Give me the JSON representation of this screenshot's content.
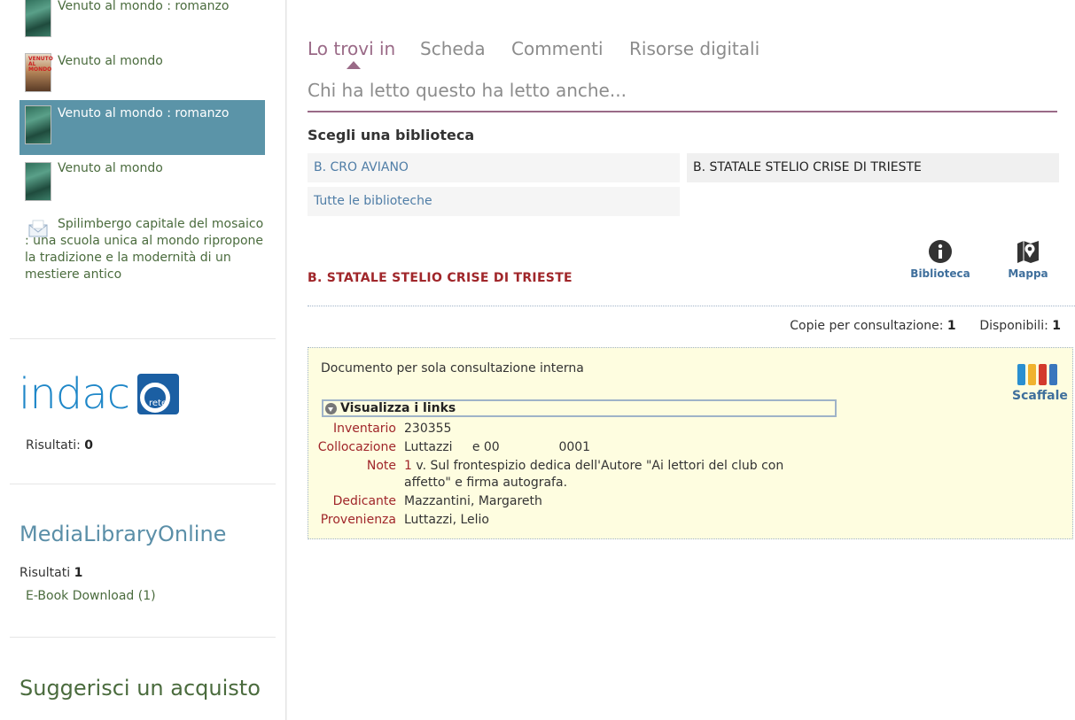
{
  "sidebar": {
    "related": [
      {
        "title": "Venuto al mondo : romanzo",
        "cover": "green"
      },
      {
        "title": "Venuto al mondo",
        "cover": "photo",
        "cover_text": "VENUTO AL MONDO"
      },
      {
        "title": "Venuto al mondo : romanzo",
        "cover": "green",
        "selected": true
      },
      {
        "title": "Venuto al mondo",
        "cover": "green"
      }
    ],
    "related_long": {
      "title": "Spilimbergo capitale del mosaico : una scuola unica al mondo ripropone la tradizione e la modernità di un mestiere antico",
      "icon": "envelope-icon"
    },
    "indaco": {
      "logo_text": "indac",
      "badge_text": "rete",
      "results_label": "Risultati:",
      "results_value": "0"
    },
    "mlol": {
      "heading": "MediaLibraryOnline",
      "results_label": "Risultati",
      "results_value": "1",
      "link": "E-Book Download (1)"
    },
    "suggest": {
      "heading": "Suggerisci un acquisto"
    }
  },
  "tabs": {
    "items": [
      "Lo trovi in",
      "Scheda",
      "Commenti",
      "Risorse digitali"
    ],
    "active": "Lo trovi in",
    "second_row": "Chi ha letto questo ha letto anche..."
  },
  "libraries": {
    "label": "Scegli una biblioteca",
    "options": [
      "B. CRO AVIANO",
      "B. STATALE STELIO CRISE DI TRIESTE",
      "Tutte le biblioteche"
    ],
    "selected": "B. STATALE STELIO CRISE DI TRIESTE"
  },
  "library_detail": {
    "name": "B. STATALE STELIO CRISE DI TRIESTE",
    "biblioteca_label": "Biblioteca",
    "mappa_label": "Mappa",
    "copies_label": "Copie per consultazione:",
    "copies_value": "1",
    "available_label": "Disponibili:",
    "available_value": "1"
  },
  "holding": {
    "description": "Documento per sola consultazione interna",
    "scaffale_label": "Scaffale",
    "links_toggle": "Visualizza i links",
    "fields": [
      {
        "label": "Inventario",
        "value": "230355"
      },
      {
        "label": "Collocazione",
        "value": "Luttazzi     e 00               0001"
      },
      {
        "label": "Note",
        "value_num": "1",
        "value": " v. Sul frontespizio dedica dell'Autore \"Ai lettori del club con affetto\" e firma autografa."
      },
      {
        "label": "Dedicante",
        "value": "Mazzantini, Margareth"
      },
      {
        "label": "Provenienza",
        "value": "Luttazzi, Lelio"
      }
    ]
  },
  "colors": {
    "accent": "#9a6a87",
    "selected_bg": "#5b94a8",
    "link_blue": "#4f7da6",
    "dark_red": "#a0262a",
    "holding_bg": "#fefde0"
  }
}
